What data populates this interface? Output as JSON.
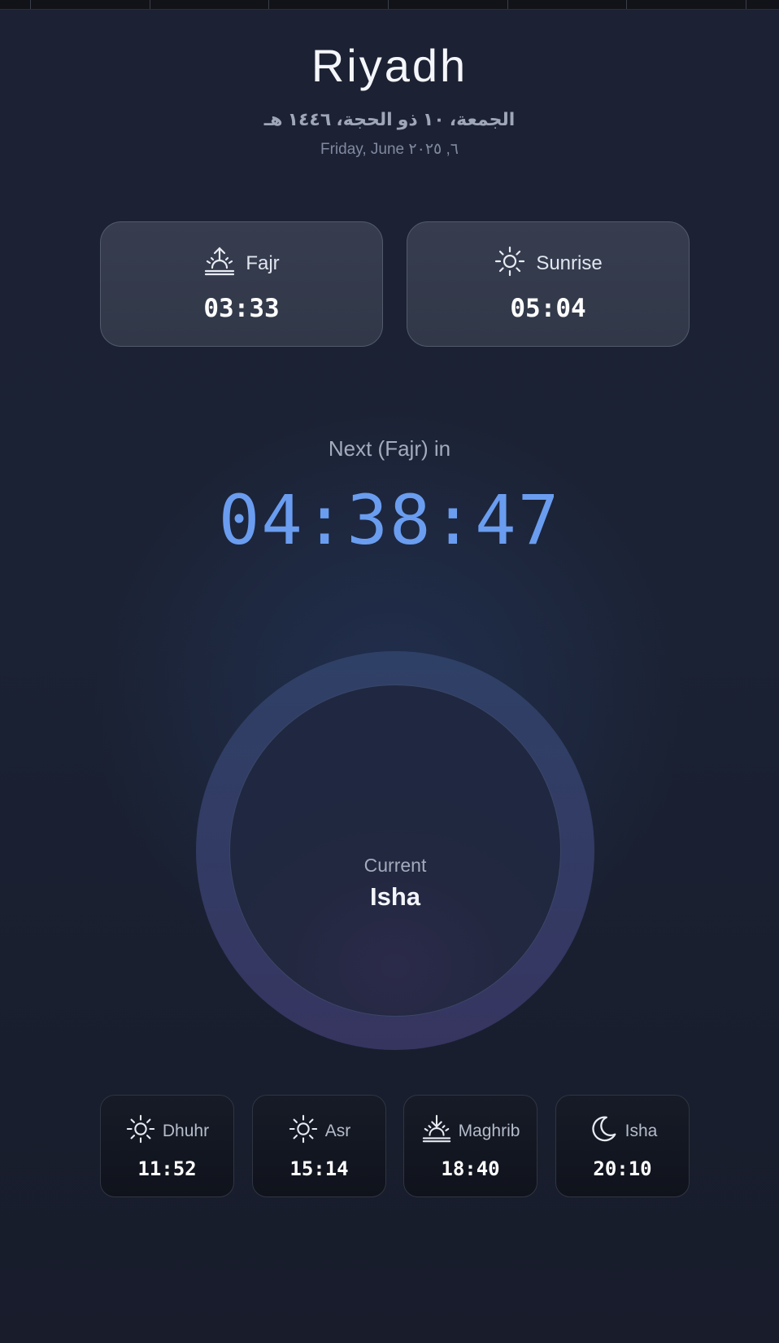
{
  "header": {
    "city": "Riyadh",
    "hijri_date": "الجمعة، ١٠ ذو الحجة، ١٤٤٦ هـ",
    "gregorian_date": "Friday, June ٦, ٢٠٢٥"
  },
  "top_cards": [
    {
      "label": "Fajr",
      "time": "03:33",
      "icon": "sunrise-up-icon"
    },
    {
      "label": "Sunrise",
      "time": "05:04",
      "icon": "sun-icon"
    }
  ],
  "next": {
    "label": "Next (Fajr) in",
    "countdown": "04:38:47"
  },
  "current": {
    "label": "Current",
    "name": "Isha"
  },
  "bottom_cards": [
    {
      "label": "Dhuhr",
      "time": "11:52",
      "icon": "sun-icon"
    },
    {
      "label": "Asr",
      "time": "15:14",
      "icon": "sun-icon"
    },
    {
      "label": "Maghrib",
      "time": "18:40",
      "icon": "sunset-down-icon"
    },
    {
      "label": "Isha",
      "time": "20:10",
      "icon": "moon-icon"
    }
  ],
  "colors": {
    "accent": "#6a9df0",
    "background": "#1b2234",
    "card": "#353b4d"
  }
}
